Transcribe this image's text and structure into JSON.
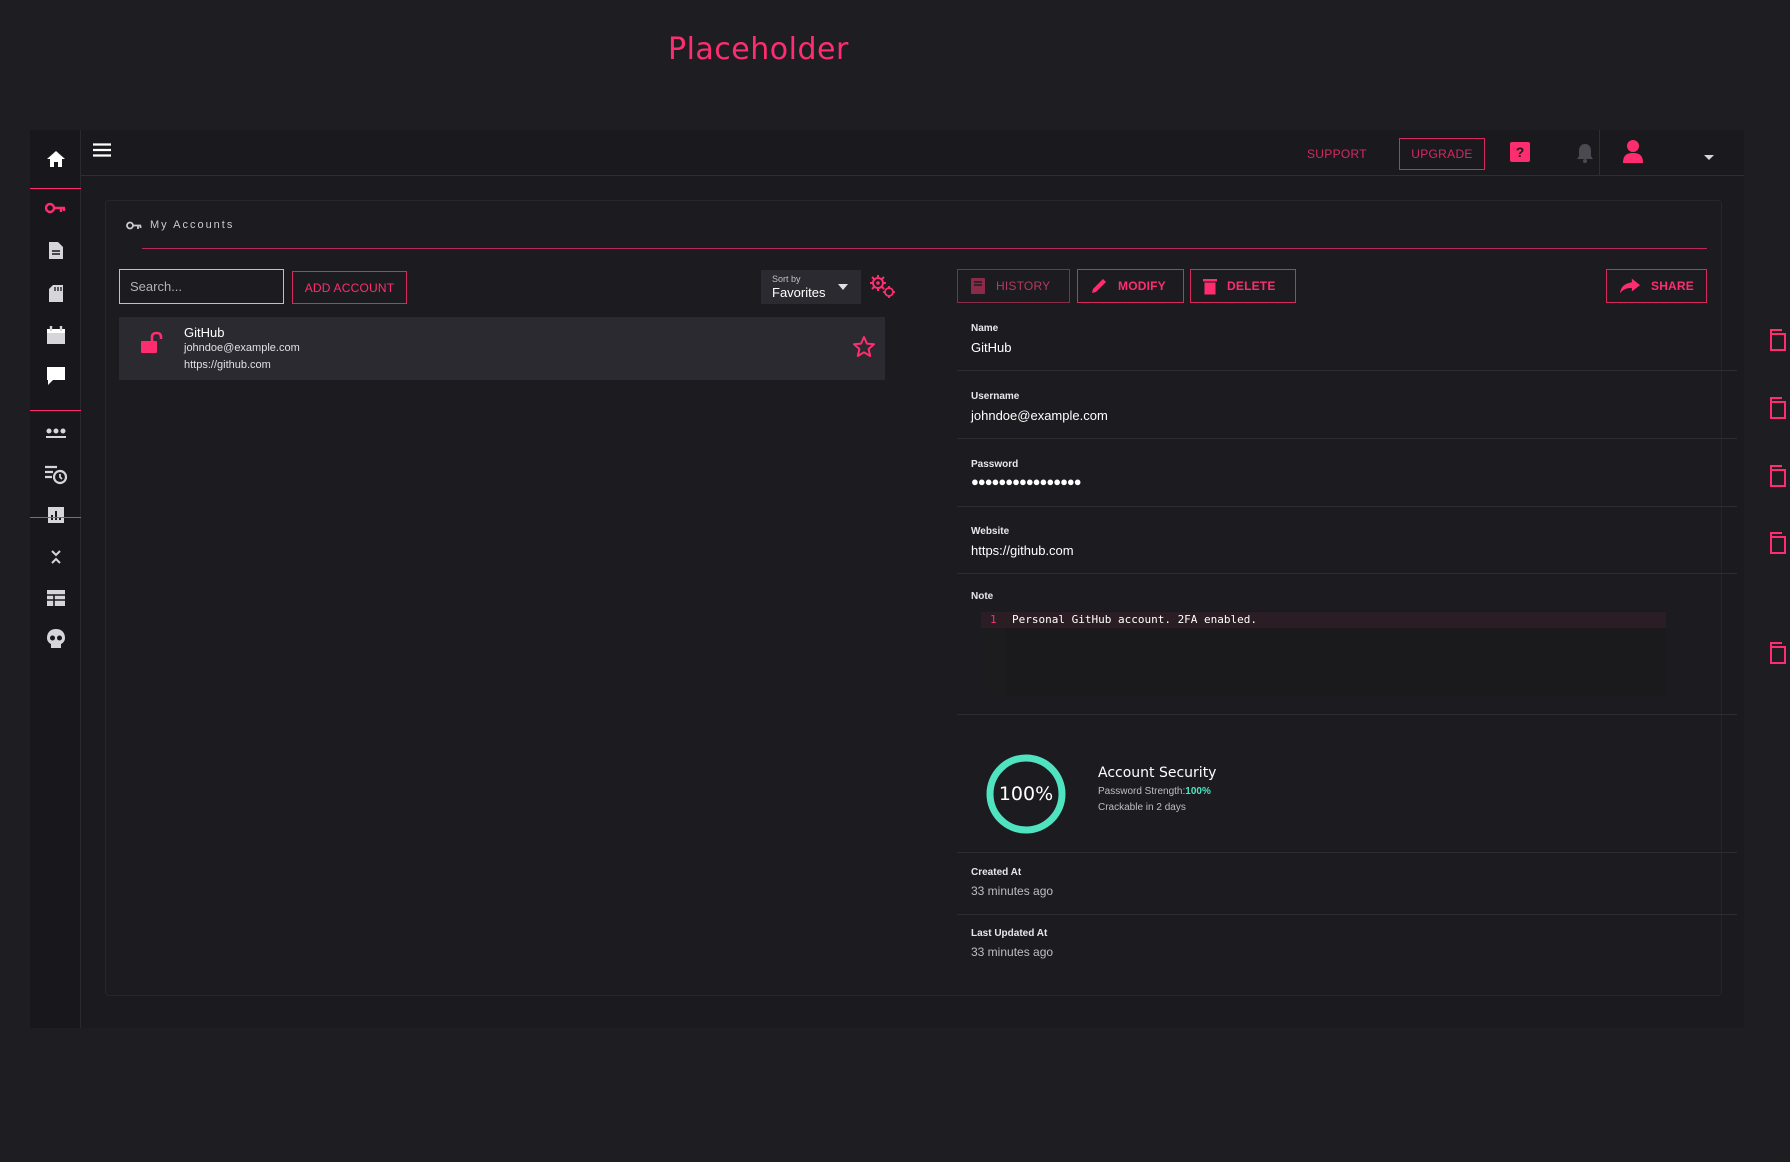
{
  "page": {
    "title": "Placeholder"
  },
  "colors": {
    "accent": "#ff2d6f",
    "security": "#4fe3c0",
    "background": "#1e1e22"
  },
  "sidebar": {
    "items": [
      {
        "icon": "home-icon"
      },
      {
        "icon": "key-icon"
      },
      {
        "icon": "document-icon"
      },
      {
        "icon": "sd-card-icon"
      },
      {
        "icon": "calendar-icon"
      },
      {
        "icon": "chat-icon"
      },
      {
        "icon": "dots-icon"
      },
      {
        "icon": "history-icon"
      },
      {
        "icon": "chart-icon"
      },
      {
        "icon": "collapse-icon"
      },
      {
        "icon": "table-icon"
      },
      {
        "icon": "skull-icon"
      }
    ]
  },
  "topbar": {
    "support_label": "SUPPORT",
    "upgrade_label": "UPGRADE"
  },
  "accounts": {
    "section_title": "My Accounts",
    "search_placeholder": "Search...",
    "add_label": "ADD ACCOUNT",
    "sort_label": "Sort by",
    "sort_value": "Favorites",
    "list": [
      {
        "name": "GitHub",
        "username": "johndoe@example.com",
        "website": "https://github.com"
      }
    ]
  },
  "detail": {
    "actions": {
      "history": "HISTORY",
      "modify": "MODIFY",
      "delete": "DELETE",
      "share": "SHARE"
    },
    "name_label": "Name",
    "name": "GitHub",
    "username_label": "Username",
    "username": "johndoe@example.com",
    "password_label": "Password",
    "password_mask": "●●●●●●●●●●●●●●●●",
    "website_label": "Website",
    "website": "https://github.com",
    "note_label": "Note",
    "note_line_number": "1",
    "note_text": "Personal GitHub account. 2FA enabled.",
    "security": {
      "percent": "100%",
      "title": "Account Security",
      "strength_label": "Password Strength:",
      "strength_value": "100%",
      "strength_fraction": 1.0,
      "crackable": "Crackable in 2 days"
    },
    "created_label": "Created At",
    "created_value": "33 minutes ago",
    "updated_label": "Last Updated At",
    "updated_value": "33 minutes ago"
  }
}
